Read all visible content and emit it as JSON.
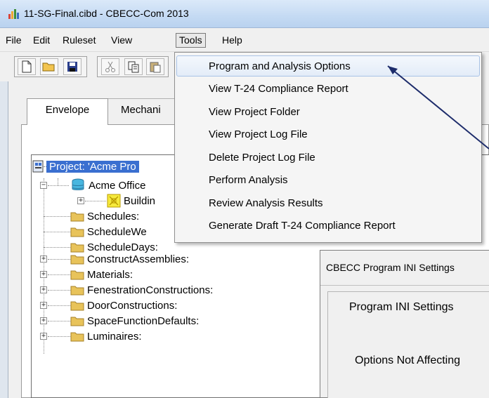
{
  "window": {
    "title": "11-SG-Final.cibd - CBECC-Com 2013"
  },
  "menubar": {
    "items": [
      "File",
      "Edit",
      "Ruleset",
      "View",
      "Tools",
      "Help"
    ]
  },
  "tabs": [
    "Envelope",
    "Mechani"
  ],
  "tree": {
    "project": "Project:  'Acme Pro",
    "building_group": "Acme Office",
    "building": "Buildin",
    "nodes": [
      "Schedules:",
      "ScheduleWe",
      "ScheduleDays:",
      "ConstructAssemblies:",
      "Materials:",
      "FenestrationConstructions:",
      "DoorConstructions:",
      "SpaceFunctionDefaults:",
      "Luminaires:"
    ]
  },
  "tools_menu": {
    "items": [
      "Program and Analysis Options",
      "View T-24 Compliance Report",
      "View Project Folder",
      "View Project Log File",
      "Delete Project Log File",
      "Perform Analysis",
      "Review Analysis Results",
      "Generate Draft T-24 Compliance Report"
    ],
    "highlighted_index": 0
  },
  "ini_dialog": {
    "title": "CBECC Program INI Settings",
    "heading": "Program INI Settings",
    "options_label": "Options Not Affecting"
  },
  "colors": {
    "selection": "#3a6fd0",
    "annotation_arrow": "#1d2c6b",
    "folder": "#e8c35a"
  }
}
